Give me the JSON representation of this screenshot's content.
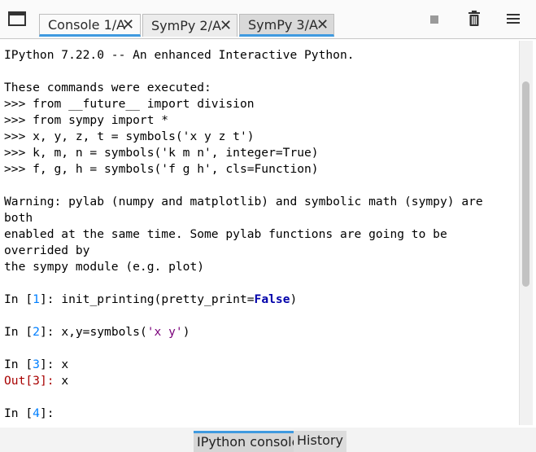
{
  "tabs": [
    {
      "label": "Console 1/A",
      "close": "✕"
    },
    {
      "label": "SymPy 2/A",
      "close": "✕"
    },
    {
      "label": "SymPy 3/A",
      "close": "✕"
    }
  ],
  "icons": [
    "window-icon",
    "stop-icon",
    "trash-icon",
    "menu-icon"
  ],
  "console": {
    "banner": "IPython 7.22.0 -- An enhanced Interactive Python.",
    "executed_header": "These commands were executed:",
    "executed": [
      ">>> from __future__ import division",
      ">>> from sympy import *",
      ">>> x, y, z, t = symbols('x y z t')",
      ">>> k, m, n = symbols('k m n', integer=True)",
      ">>> f, g, h = symbols('f g h', cls=Function)"
    ],
    "warning": [
      "Warning: pylab (numpy and matplotlib) and symbolic math (sympy) are",
      "both",
      "enabled at the same time. Some pylab functions are going to be",
      "overrided by",
      "the sympy module (e.g. plot)"
    ],
    "in_prefix": "In [",
    "in_suffix": "]: ",
    "out_prefix": "Out[",
    "out_suffix": "]: ",
    "cells": [
      {
        "n": "1",
        "code_a": "init_printing(pretty_print=",
        "code_kw": "False",
        "code_b": ")"
      },
      {
        "n": "2",
        "code_a": "x,y=symbols(",
        "code_str": "'x y'",
        "code_b": ")"
      },
      {
        "n": "3",
        "code": "x",
        "out": "x"
      },
      {
        "n": "4"
      }
    ]
  },
  "bottom_tabs": [
    {
      "label": "IPython console"
    },
    {
      "label": "History"
    }
  ],
  "colors": {
    "accent": "#3f9ae0",
    "prompt_number": "#007fff",
    "out_label": "#a80000",
    "string": "#7a007a"
  }
}
